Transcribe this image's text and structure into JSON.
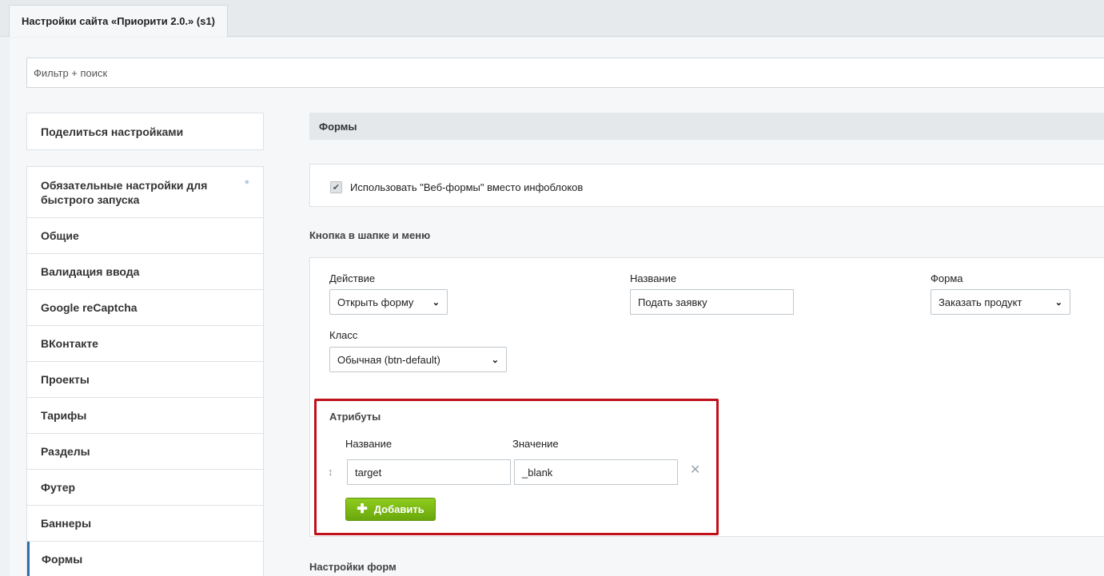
{
  "tab": {
    "title": "Настройки сайта «Приорити 2.0.» (s1)"
  },
  "filter": {
    "placeholder": "Фильтр + поиск"
  },
  "sidebar": {
    "share_label": "Поделиться настройками",
    "items": [
      {
        "label": "Обязательные настройки для быстрого запуска"
      },
      {
        "label": "Общие"
      },
      {
        "label": "Валидация ввода"
      },
      {
        "label": "Google reCaptcha"
      },
      {
        "label": "ВКонтакте"
      },
      {
        "label": "Проекты"
      },
      {
        "label": "Тарифы"
      },
      {
        "label": "Разделы"
      },
      {
        "label": "Футер"
      },
      {
        "label": "Баннеры"
      },
      {
        "label": "Формы"
      }
    ],
    "star": "*"
  },
  "main": {
    "section_title": "Формы",
    "webforms_checkbox": {
      "label": "Использовать \"Веб-формы\" вместо инфоблоков",
      "checked": true
    },
    "header_button_title": "Кнопка в шапке и меню",
    "action": {
      "label": "Действие",
      "value": "Открыть форму"
    },
    "name": {
      "label": "Название",
      "value": "Подать заявку"
    },
    "form": {
      "label": "Форма",
      "value": "Заказать продукт"
    },
    "class": {
      "label": "Класс",
      "value": "Обычная (btn-default)"
    },
    "attributes": {
      "title": "Атрибуты",
      "name_header": "Название",
      "value_header": "Значение",
      "rows": [
        {
          "name": "target",
          "value": "_blank"
        }
      ],
      "add_label": "Добавить"
    },
    "form_settings_title": "Настройки форм"
  },
  "colors": {
    "accent": "#2e6fa8",
    "highlight": "#c0101a",
    "add_button": "#7ab814"
  }
}
